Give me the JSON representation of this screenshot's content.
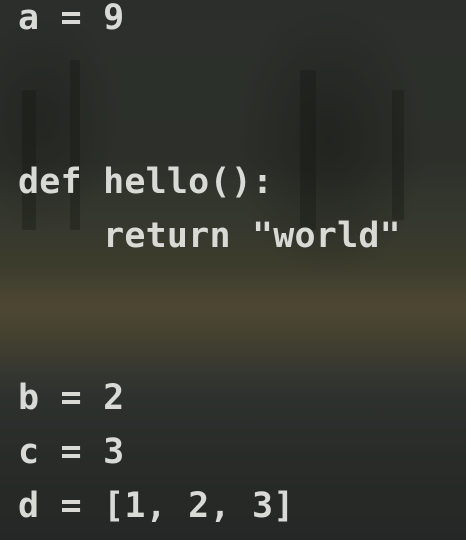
{
  "editor": {
    "lines": [
      "a = 9",
      "def hello():",
      "    return \"world\"",
      "b = 2",
      "c = 3",
      "d = [1, 2, 3]"
    ]
  },
  "colors": {
    "code_text": "#d9d9d6"
  }
}
